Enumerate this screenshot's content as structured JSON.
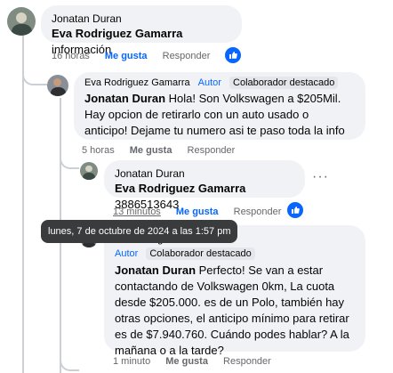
{
  "comment1": {
    "author": "Jonatan Duran",
    "mention": "Eva Rodriguez Gamarra",
    "text": " información",
    "time": "16 horas",
    "like": "Me gusta",
    "reply": "Responder"
  },
  "comment2": {
    "author": "Eva Rodriguez Gamarra",
    "badge_author": "Autor",
    "badge_contrib": "Colaborador destacado",
    "mention": "Jonatan Duran",
    "text": " Hola! Son Volkswagen a $205Mil. Hay opcion de retirarlo con un auto usado o anticipo! Dejame tu numero asi te paso toda la info",
    "time": "5 horas",
    "like": "Me gusta",
    "reply": "Responder"
  },
  "comment3": {
    "author": "Jonatan Duran",
    "mention": "Eva Rodriguez Gamarra",
    "text": " 3886513643",
    "time": "13 minutos",
    "like": "Me gusta",
    "reply": "Responder",
    "more": "···"
  },
  "tooltip": "lunes, 7 de octubre de 2024 a las 1:57 pm",
  "comment4": {
    "author": "Eva Rodriguez Gamarra",
    "badge_author": "Autor",
    "badge_contrib": "Colaborador destacado",
    "mention": "Jonatan Duran",
    "text": " Perfecto! Se van a estar contactando de Volkswagen 0km, La cuota desde $205.000. es de un Polo, también hay otras opciones, el anticipo mínimo para retirar es de $7.940.760. Cuándo podes hablar? A la mañana o a la tarde?",
    "time": "1 minuto",
    "like": "Me gusta",
    "reply": "Responder"
  },
  "colors": {
    "accent": "#0866ff",
    "bubble": "#f0f2f5",
    "meta": "#65676b"
  },
  "icons": [
    "like-icon",
    "more-options-icon"
  ]
}
